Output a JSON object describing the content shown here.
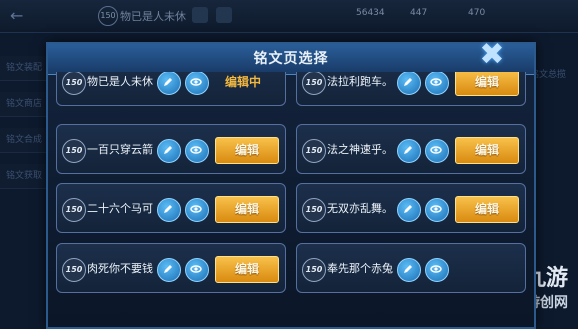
{
  "background": {
    "back_icon": "back-arrow-icon",
    "level_badge": "150",
    "title": "物已是人未休",
    "currency1": "56434",
    "currency2": "447",
    "currency3": "470",
    "side_items": [
      "铭文装配",
      "铭文商店",
      "铭文合成",
      "铭文获取"
    ],
    "right_tab": "铭文总揽",
    "watermark_brand": "九游",
    "watermark_sub": "游创网"
  },
  "dialog": {
    "title": "铭文页选择",
    "close_icon": "close-x-icon",
    "edit_label": "编辑",
    "editing_label": "编辑中",
    "level": "150",
    "pages": [
      {
        "name": "物已是人未休",
        "state": "editing"
      },
      {
        "name": "法拉利跑车。",
        "state": "edit"
      },
      {
        "name": "一百只穿云箭",
        "state": "edit"
      },
      {
        "name": "法之神速乎。",
        "state": "edit"
      },
      {
        "name": "二十六个马可",
        "state": "edit"
      },
      {
        "name": "无双亦乱舞。",
        "state": "edit"
      },
      {
        "name": "肉死你不要钱",
        "state": "edit"
      },
      {
        "name": "奉先那个赤兔",
        "state": "edit"
      }
    ]
  },
  "colors": {
    "accent_orange": "#f1b73f",
    "header_blue": "#2a5e99",
    "icon_blue": "#1d6fb5"
  }
}
